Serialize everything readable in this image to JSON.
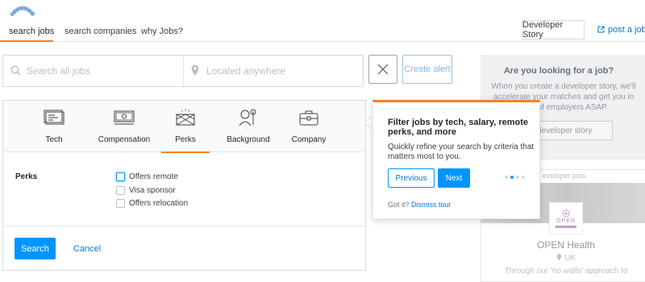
{
  "header": {
    "logo_icon": "jobs-logo-icon",
    "tabs": [
      {
        "label": "search jobs",
        "active": true
      },
      {
        "label": "search companies",
        "active": false
      },
      {
        "label": "why Jobs?",
        "active": false
      }
    ],
    "developer_story_label": "Developer Story",
    "post_job_label": "post a job",
    "accent_color": "#f48024"
  },
  "search": {
    "jobs_placeholder": "Search all jobs",
    "location_placeholder": "Located anywhere",
    "clear_icon": "close-icon",
    "create_alert_label": "Create alert"
  },
  "filters": {
    "categories": [
      {
        "label": "Tech",
        "icon": "tech-icon",
        "active": false
      },
      {
        "label": "Compensation",
        "icon": "money-icon",
        "active": false
      },
      {
        "label": "Perks",
        "icon": "perks-icon",
        "active": true
      },
      {
        "label": "Background",
        "icon": "background-icon",
        "active": false
      },
      {
        "label": "Company",
        "icon": "briefcase-icon",
        "active": false
      }
    ],
    "section_label": "Perks",
    "options": [
      {
        "label": "Offers remote",
        "checked": false
      },
      {
        "label": "Visa sponsor",
        "checked": false
      },
      {
        "label": "Offers relocation",
        "checked": false
      }
    ],
    "search_label": "Search",
    "cancel_label": "Cancel"
  },
  "tour": {
    "title": "Filter jobs by tech, salary, remote perks, and more",
    "text": "Quickly refine your search by criteria that matters most to you.",
    "previous_label": "Previous",
    "next_label": "Next",
    "step_current": 2,
    "step_total": 4,
    "got_it_text": "Got it?",
    "dismiss_label": "Dismiss tour"
  },
  "sidebar": {
    "promo_title": "Are you looking for a job?",
    "promo_text": "When you create a developer story, we'll accelerate your matches and get you in front of employers ASAP.",
    "promo_button": "a developer story",
    "card_label": "eveloper jobs",
    "company_logo_text": "OPEN",
    "company_name": "OPEN Health",
    "company_location": "UK",
    "company_desc": "Through our 'no walls' approach to"
  }
}
